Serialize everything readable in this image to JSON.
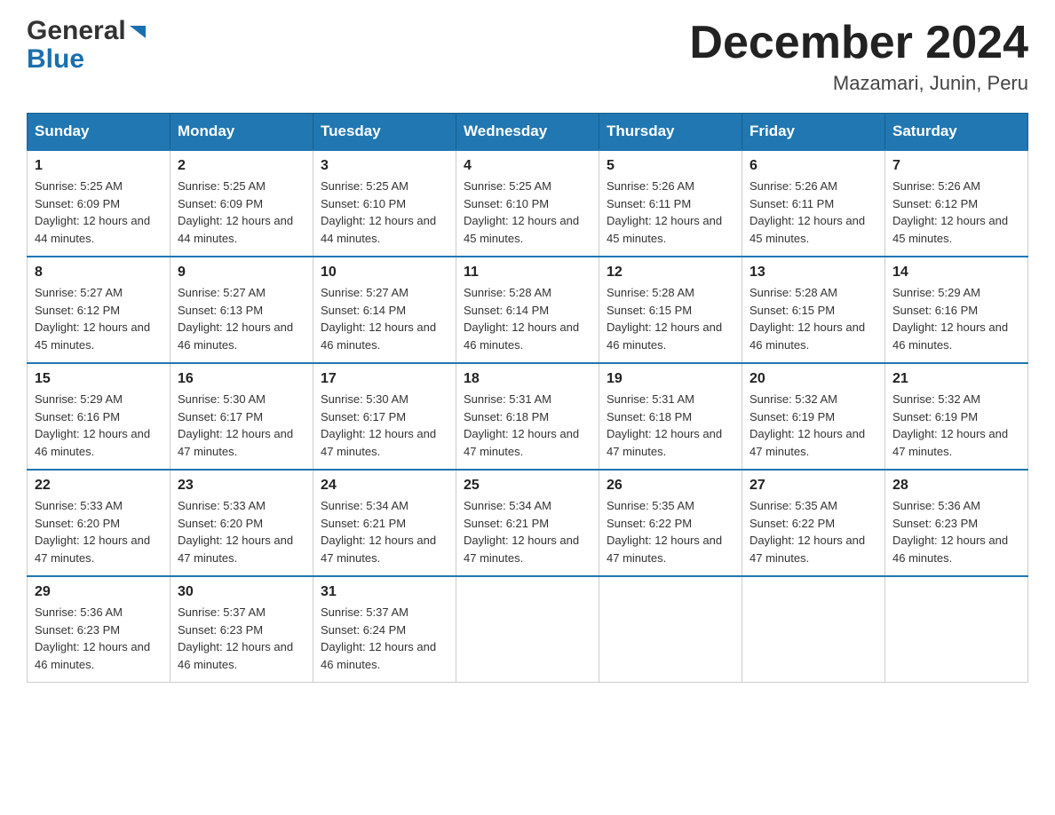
{
  "header": {
    "logo_general": "General",
    "logo_blue": "Blue",
    "month_title": "December 2024",
    "location": "Mazamari, Junin, Peru"
  },
  "weekdays": [
    "Sunday",
    "Monday",
    "Tuesday",
    "Wednesday",
    "Thursday",
    "Friday",
    "Saturday"
  ],
  "weeks": [
    [
      {
        "day": "1",
        "sunrise": "5:25 AM",
        "sunset": "6:09 PM",
        "daylight": "12 hours and 44 minutes."
      },
      {
        "day": "2",
        "sunrise": "5:25 AM",
        "sunset": "6:09 PM",
        "daylight": "12 hours and 44 minutes."
      },
      {
        "day": "3",
        "sunrise": "5:25 AM",
        "sunset": "6:10 PM",
        "daylight": "12 hours and 44 minutes."
      },
      {
        "day": "4",
        "sunrise": "5:25 AM",
        "sunset": "6:10 PM",
        "daylight": "12 hours and 45 minutes."
      },
      {
        "day": "5",
        "sunrise": "5:26 AM",
        "sunset": "6:11 PM",
        "daylight": "12 hours and 45 minutes."
      },
      {
        "day": "6",
        "sunrise": "5:26 AM",
        "sunset": "6:11 PM",
        "daylight": "12 hours and 45 minutes."
      },
      {
        "day": "7",
        "sunrise": "5:26 AM",
        "sunset": "6:12 PM",
        "daylight": "12 hours and 45 minutes."
      }
    ],
    [
      {
        "day": "8",
        "sunrise": "5:27 AM",
        "sunset": "6:12 PM",
        "daylight": "12 hours and 45 minutes."
      },
      {
        "day": "9",
        "sunrise": "5:27 AM",
        "sunset": "6:13 PM",
        "daylight": "12 hours and 46 minutes."
      },
      {
        "day": "10",
        "sunrise": "5:27 AM",
        "sunset": "6:14 PM",
        "daylight": "12 hours and 46 minutes."
      },
      {
        "day": "11",
        "sunrise": "5:28 AM",
        "sunset": "6:14 PM",
        "daylight": "12 hours and 46 minutes."
      },
      {
        "day": "12",
        "sunrise": "5:28 AM",
        "sunset": "6:15 PM",
        "daylight": "12 hours and 46 minutes."
      },
      {
        "day": "13",
        "sunrise": "5:28 AM",
        "sunset": "6:15 PM",
        "daylight": "12 hours and 46 minutes."
      },
      {
        "day": "14",
        "sunrise": "5:29 AM",
        "sunset": "6:16 PM",
        "daylight": "12 hours and 46 minutes."
      }
    ],
    [
      {
        "day": "15",
        "sunrise": "5:29 AM",
        "sunset": "6:16 PM",
        "daylight": "12 hours and 46 minutes."
      },
      {
        "day": "16",
        "sunrise": "5:30 AM",
        "sunset": "6:17 PM",
        "daylight": "12 hours and 47 minutes."
      },
      {
        "day": "17",
        "sunrise": "5:30 AM",
        "sunset": "6:17 PM",
        "daylight": "12 hours and 47 minutes."
      },
      {
        "day": "18",
        "sunrise": "5:31 AM",
        "sunset": "6:18 PM",
        "daylight": "12 hours and 47 minutes."
      },
      {
        "day": "19",
        "sunrise": "5:31 AM",
        "sunset": "6:18 PM",
        "daylight": "12 hours and 47 minutes."
      },
      {
        "day": "20",
        "sunrise": "5:32 AM",
        "sunset": "6:19 PM",
        "daylight": "12 hours and 47 minutes."
      },
      {
        "day": "21",
        "sunrise": "5:32 AM",
        "sunset": "6:19 PM",
        "daylight": "12 hours and 47 minutes."
      }
    ],
    [
      {
        "day": "22",
        "sunrise": "5:33 AM",
        "sunset": "6:20 PM",
        "daylight": "12 hours and 47 minutes."
      },
      {
        "day": "23",
        "sunrise": "5:33 AM",
        "sunset": "6:20 PM",
        "daylight": "12 hours and 47 minutes."
      },
      {
        "day": "24",
        "sunrise": "5:34 AM",
        "sunset": "6:21 PM",
        "daylight": "12 hours and 47 minutes."
      },
      {
        "day": "25",
        "sunrise": "5:34 AM",
        "sunset": "6:21 PM",
        "daylight": "12 hours and 47 minutes."
      },
      {
        "day": "26",
        "sunrise": "5:35 AM",
        "sunset": "6:22 PM",
        "daylight": "12 hours and 47 minutes."
      },
      {
        "day": "27",
        "sunrise": "5:35 AM",
        "sunset": "6:22 PM",
        "daylight": "12 hours and 47 minutes."
      },
      {
        "day": "28",
        "sunrise": "5:36 AM",
        "sunset": "6:23 PM",
        "daylight": "12 hours and 46 minutes."
      }
    ],
    [
      {
        "day": "29",
        "sunrise": "5:36 AM",
        "sunset": "6:23 PM",
        "daylight": "12 hours and 46 minutes."
      },
      {
        "day": "30",
        "sunrise": "5:37 AM",
        "sunset": "6:23 PM",
        "daylight": "12 hours and 46 minutes."
      },
      {
        "day": "31",
        "sunrise": "5:37 AM",
        "sunset": "6:24 PM",
        "daylight": "12 hours and 46 minutes."
      },
      null,
      null,
      null,
      null
    ]
  ]
}
